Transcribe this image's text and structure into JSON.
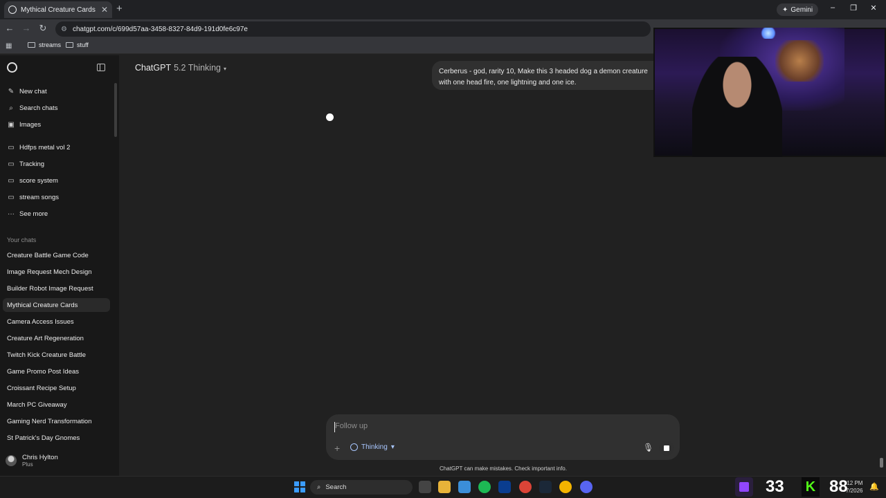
{
  "browser": {
    "tab_title": "Mythical Creature Cards",
    "new_tab": "+",
    "gemini_label": "Gemini",
    "url": "chatgpt.com/c/699d57aa-3458-8327-84d9-191d0fe6c97e",
    "bookmarks": [
      {
        "label": "streams"
      },
      {
        "label": "stuff"
      }
    ]
  },
  "sidebar": {
    "actions": [
      {
        "label": "New chat",
        "icon": "new-chat-icon"
      },
      {
        "label": "Search chats",
        "icon": "search-icon"
      },
      {
        "label": "Images",
        "icon": "images-icon"
      }
    ],
    "projects": [
      {
        "label": "Hdfps metal vol 2",
        "icon": "folder-icon"
      },
      {
        "label": "Tracking",
        "icon": "folder-icon"
      },
      {
        "label": "score system",
        "icon": "folder-icon"
      },
      {
        "label": "stream songs",
        "icon": "folder-icon"
      }
    ],
    "see_more": "See more",
    "chats_heading": "Your chats",
    "chats": [
      {
        "label": "Creature Battle Game Code"
      },
      {
        "label": "Image Request Mech Design"
      },
      {
        "label": "Builder Robot Image Request"
      },
      {
        "label": "Mythical Creature Cards",
        "active": true
      },
      {
        "label": "Camera Access Issues"
      },
      {
        "label": "Creature Art Regeneration"
      },
      {
        "label": "Twitch Kick Creature Battle"
      },
      {
        "label": "Game Promo Post Ideas"
      },
      {
        "label": "Croissant Recipe Setup"
      },
      {
        "label": "March PC Giveaway"
      },
      {
        "label": "Gaming Nerd Transformation"
      },
      {
        "label": "St Patrick's Day Gnomes"
      }
    ],
    "user": {
      "name": "Chris Hylton",
      "plan": "Plus"
    }
  },
  "main": {
    "model_name": "ChatGPT",
    "model_version": "5.2 Thinking",
    "user_message": "Cerberus - god, rarity 10, Make this 3 headed dog a demon creature with one head fire, one lightning and one ice.",
    "composer": {
      "placeholder": "Follow up",
      "mode_label": "Thinking"
    },
    "disclaimer": "ChatGPT can make mistakes. Check important info."
  },
  "taskbar": {
    "search_label": "Search",
    "twitch_count": "33",
    "kick_count": "88",
    "time": "12 PM",
    "date": "7/2026"
  }
}
